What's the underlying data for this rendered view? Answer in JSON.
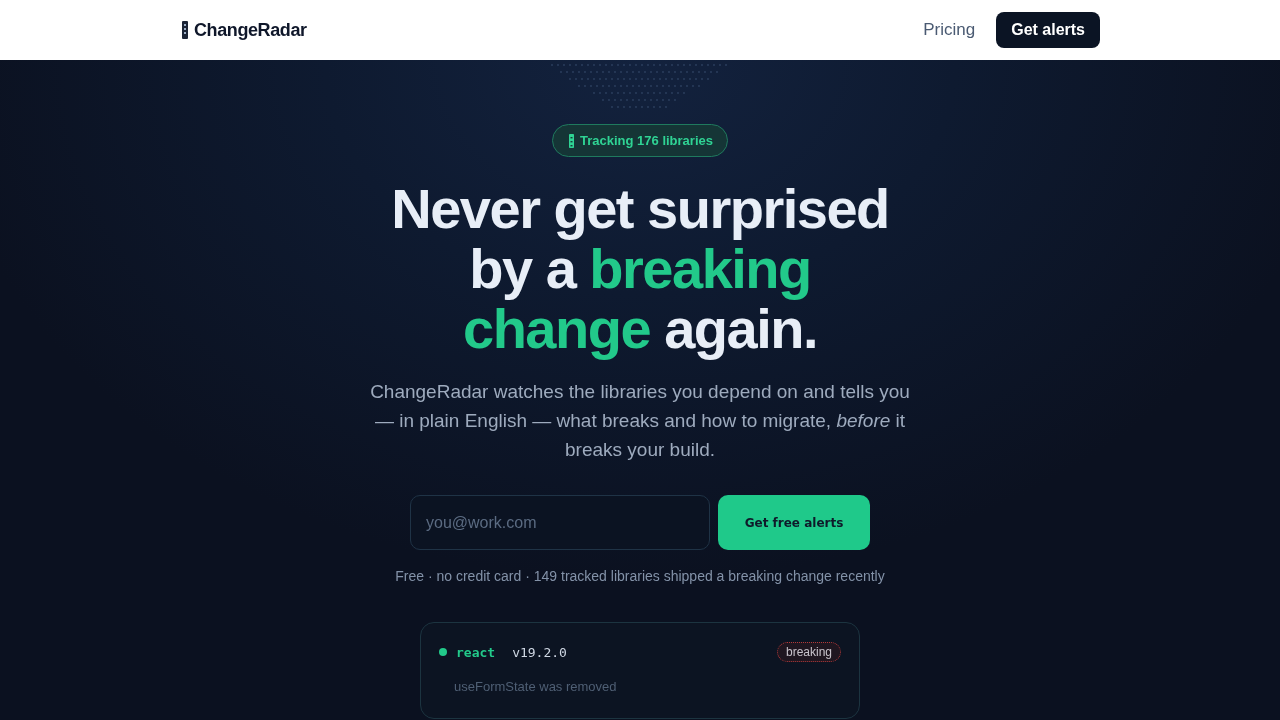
{
  "header": {
    "brand": "ChangeRadar",
    "nav_links": [
      "Pricing"
    ],
    "cta": "Get alerts"
  },
  "hero": {
    "badge": "Tracking 176 libraries",
    "headline": [
      {
        "text": "Never get surprised by a ",
        "highlight": false
      },
      {
        "text": "breaking change",
        "highlight": true
      },
      {
        "text": " again.",
        "highlight": false
      }
    ],
    "description": "ChangeRadar watches the libraries you depend on and tells you — in plain English — what breaks and how to migrate, *before* it breaks your build.",
    "signup": {
      "placeholder": "you@work.com",
      "button": "Get free alerts"
    },
    "fine_print": "Free · no credit card · 149 tracked libraries shipped a breaking change recently"
  },
  "changes": [
    {
      "package": "react",
      "version": "v19.2.0",
      "tag": "breaking",
      "summary": "useFormState was removed"
    }
  ]
}
